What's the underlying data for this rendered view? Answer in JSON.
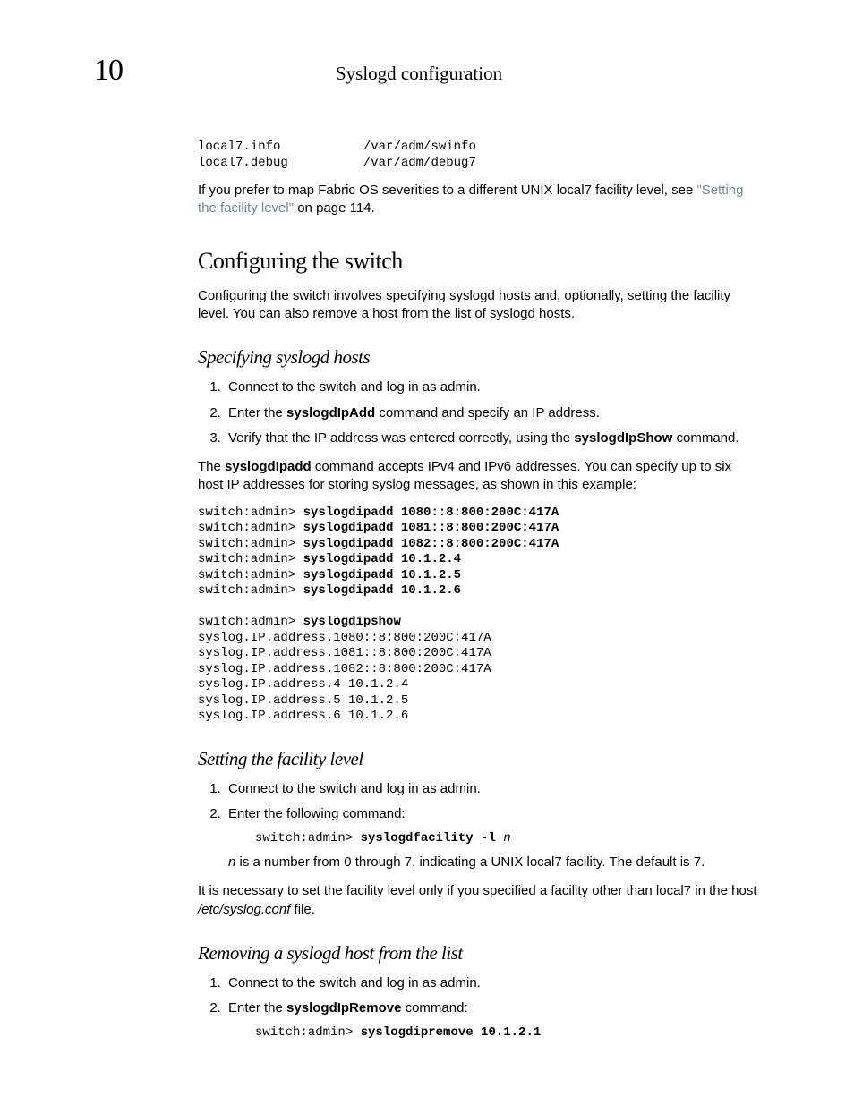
{
  "header": {
    "chapter": "10",
    "title": "Syslogd configuration"
  },
  "pre1": {
    "l1a": "local7.info",
    "l1b": "/var/adm/swinfo",
    "l2a": "local7.debug",
    "l2b": "/var/adm/debug7"
  },
  "para_xref": {
    "before": "If you prefer to map Fabric OS severities to a different UNIX local7 facility level, see ",
    "link": "\"Setting the facility level\"",
    "after": " on page 114."
  },
  "h2_configuring": "Configuring the switch",
  "p_configuring": "Configuring the switch involves specifying syslogd hosts and, optionally, setting the facility level. You can also remove a host from the list of syslogd hosts.",
  "h3_specifying": "Specifying syslogd hosts",
  "spec_steps": {
    "s1": "Connect to the switch and log in as admin.",
    "s2a": "Enter the ",
    "s2b": "syslogdIpAdd",
    "s2c": " command and specify an IP address.",
    "s3a": "Verify that the IP address was entered correctly, using the ",
    "s3b": "syslogdIpShow",
    "s3c": " command."
  },
  "p_syslogdip": {
    "a": "The ",
    "b": "syslogdIpadd",
    "c": " command accepts IPv4 and IPv6 addresses. You can specify up to six host IP addresses for storing syslog messages, as shown in this example:"
  },
  "codeblock1": {
    "p": "switch:admin> ",
    "c1": "syslogdipadd 1080::8:800:200C:417A",
    "c2": "syslogdipadd 1081::8:800:200C:417A",
    "c3": "syslogdipadd 1082::8:800:200C:417A",
    "c4": "syslogdipadd 10.1.2.4",
    "c5": "syslogdipadd 10.1.2.5",
    "c6": "syslogdipadd 10.1.2.6",
    "c7": "syslogdipshow",
    "o1": "syslog.IP.address.1080::8:800:200C:417A",
    "o2": "syslog.IP.address.1081::8:800:200C:417A",
    "o3": "syslog.IP.address.1082::8:800:200C:417A",
    "o4": "syslog.IP.address.4 10.1.2.4",
    "o5": "syslog.IP.address.5 10.1.2.5",
    "o6": "syslog.IP.address.6 10.1.2.6"
  },
  "h3_facility": "Setting the facility level",
  "fac_steps": {
    "s1": "Connect to the switch and log in as admin.",
    "s2": "Enter the following command:"
  },
  "fac_cmd": {
    "p": "switch:admin> ",
    "c": "syslogdfacility -l ",
    "arg": "n"
  },
  "fac_desc": {
    "a": "n",
    "b": " is a number from 0 through 7, indicating a UNIX local7 facility. The default is 7."
  },
  "fac_note": {
    "a": "It is necessary to set the facility level only if you specified a facility other than local7 in the host ",
    "b": "/etc/syslog.conf",
    "c": " file."
  },
  "h3_removing": "Removing a syslogd host from the list",
  "rem_steps": {
    "s1": "Connect to the switch and log in as admin.",
    "s2a": "Enter the ",
    "s2b": "syslogdIpRemove",
    "s2c": " command:"
  },
  "rem_cmd": {
    "p": "switch:admin> ",
    "c": "syslogdipremove 10.1.2.1"
  }
}
